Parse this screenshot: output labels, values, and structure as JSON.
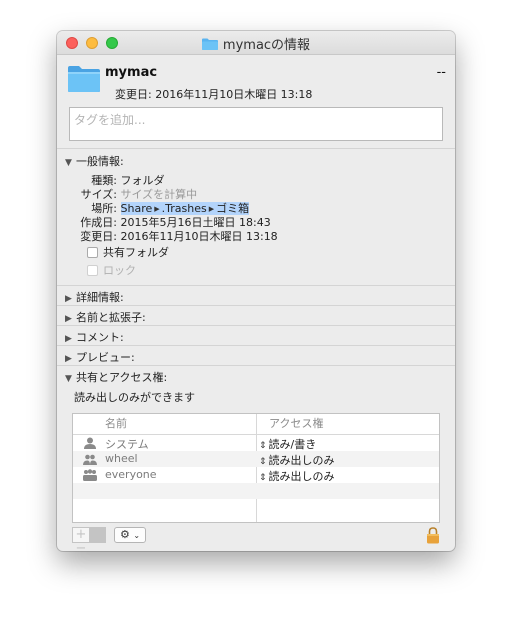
{
  "window": {
    "title": "mymacの情報"
  },
  "header": {
    "name": "mymac",
    "size": "--",
    "modified_line": "変更日: 2016年11月10日木曜日 13:18",
    "tags_placeholder": "タグを追加..."
  },
  "general": {
    "heading": "一般情報:",
    "kind_label": "種類:",
    "kind_value": "フォルダ",
    "size_label": "サイズ:",
    "size_value": "サイズを計算中",
    "where_label": "場所:",
    "where_path": [
      "Share",
      ".Trashes",
      "ゴミ箱"
    ],
    "created_label": "作成日:",
    "created_value": "2015年5月16日土曜日 18:43",
    "modified_label": "変更日:",
    "modified_value": "2016年11月10日木曜日 13:18",
    "shared_folder": "共有フォルダ",
    "locked": "ロック"
  },
  "sections": {
    "more_info": "詳細情報:",
    "name_ext": "名前と拡張子:",
    "comments": "コメント:",
    "preview": "プレビュー:",
    "sharing": "共有とアクセス権:"
  },
  "sharing": {
    "status": "読み出しのみができます",
    "col_name": "名前",
    "col_privilege": "アクセス権",
    "rows": [
      {
        "name": "システム",
        "privilege": "読み/書き",
        "icon": "user-icon"
      },
      {
        "name": "wheel",
        "privilege": "読み出しのみ",
        "icon": "group-icon"
      },
      {
        "name": "everyone",
        "privilege": "読み出しのみ",
        "icon": "everyone-icon"
      }
    ]
  },
  "toolbar": {
    "add": "+",
    "remove": "−",
    "action": "⚙"
  },
  "colors": {
    "folder": "#5ab4f0",
    "selection": "#b3d4fb",
    "lock": "#e8a23a"
  }
}
